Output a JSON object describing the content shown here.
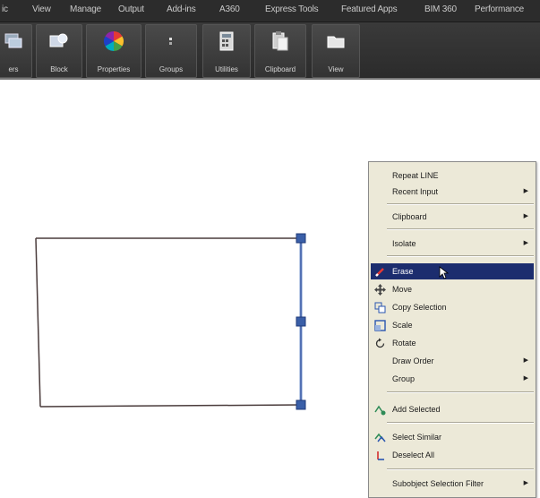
{
  "ribbon": {
    "tabs": [
      "ic",
      "View",
      "Manage",
      "Output",
      "Add-ins",
      "A360",
      "Express Tools",
      "Featured Apps",
      "BIM 360",
      "Performance"
    ],
    "panels": [
      {
        "label": "ers",
        "icon": "layers-icon"
      },
      {
        "label": "Block",
        "icon": "block-icon"
      },
      {
        "label": "Properties",
        "icon": "properties-color-wheel-icon"
      },
      {
        "label": "Groups",
        "icon": "groups-icon"
      },
      {
        "label": "Utilities",
        "icon": "utilities-calculator-icon"
      },
      {
        "label": "Clipboard",
        "icon": "clipboard-icon"
      },
      {
        "label": "View",
        "icon": "view-icon"
      }
    ]
  },
  "context_menu": {
    "items": [
      {
        "label": "Repeat LINE",
        "submenu": false,
        "icon": null
      },
      {
        "label": "Recent Input",
        "submenu": true,
        "icon": null
      },
      {
        "label": "Clipboard",
        "submenu": true,
        "icon": null
      },
      {
        "label": "Isolate",
        "submenu": true,
        "icon": null
      },
      {
        "label": "Erase",
        "submenu": false,
        "icon": "eraser-icon",
        "highlighted": true
      },
      {
        "label": "Move",
        "submenu": false,
        "icon": "move-icon"
      },
      {
        "label": "Copy Selection",
        "submenu": false,
        "icon": "copy-icon"
      },
      {
        "label": "Scale",
        "submenu": false,
        "icon": "scale-icon"
      },
      {
        "label": "Rotate",
        "submenu": false,
        "icon": "rotate-icon"
      },
      {
        "label": "Draw Order",
        "submenu": true,
        "icon": null
      },
      {
        "label": "Group",
        "submenu": true,
        "icon": null
      },
      {
        "label": "Add Selected",
        "submenu": false,
        "icon": "add-selected-icon"
      },
      {
        "label": "Select Similar",
        "submenu": false,
        "icon": "select-similar-icon"
      },
      {
        "label": "Deselect All",
        "submenu": false,
        "icon": "deselect-icon"
      },
      {
        "label": "Subobject Selection Filter",
        "submenu": true,
        "icon": null
      }
    ],
    "highlight_color": "#1c2d6e"
  },
  "colors": {
    "ribbon_bg": "#2b2b2b",
    "grip": "#3a5fa8",
    "selected_line": "#5a7fc4",
    "menu_bg": "#ece9d8"
  }
}
